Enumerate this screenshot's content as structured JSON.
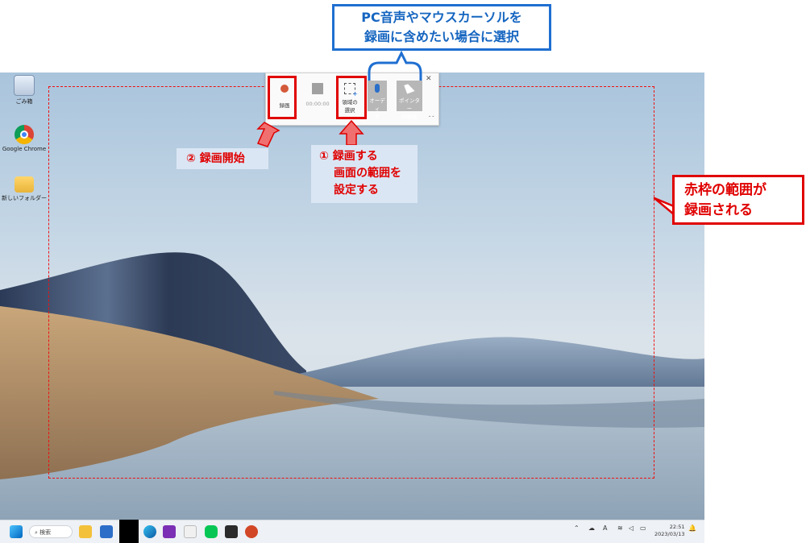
{
  "desktop": {
    "icons": [
      {
        "label": "ごみ箱",
        "icon": "recycle-bin-icon"
      },
      {
        "label": "Google Chrome",
        "icon": "chrome-icon"
      },
      {
        "label": "新しいフォルダー",
        "icon": "folder-icon"
      }
    ]
  },
  "toolbar": {
    "record_label": "録画",
    "timer": "00:00:00",
    "select_area_label_1": "領域の",
    "select_area_label_2": "選択",
    "audio_label_1": "オーディ",
    "audio_label_2": "オ",
    "pointer_label_1": "ポインター",
    "pointer_label_2": "の録画",
    "close_glyph": "✕",
    "expand_glyph": "⌄⌄"
  },
  "annotations": {
    "top_callout_line1": "PC音声やマウスカーソルを",
    "top_callout_line2": "録画に含めたい場合に選択",
    "step2": "② 録画開始",
    "step1_line1": "① 録画する",
    "step1_line2": "画面の範囲を",
    "step1_line3": "設定する",
    "right_callout_line1": "赤枠の範囲が",
    "right_callout_line2": "録画される"
  },
  "taskbar": {
    "search_label": "検索",
    "tray_ime": "A",
    "clock_time": "22:51",
    "clock_date": "2023/03/13"
  },
  "colors": {
    "annotation_red": "#e00000",
    "annotation_blue": "#1f6fd1",
    "label_bg": "#dbe6f4"
  }
}
